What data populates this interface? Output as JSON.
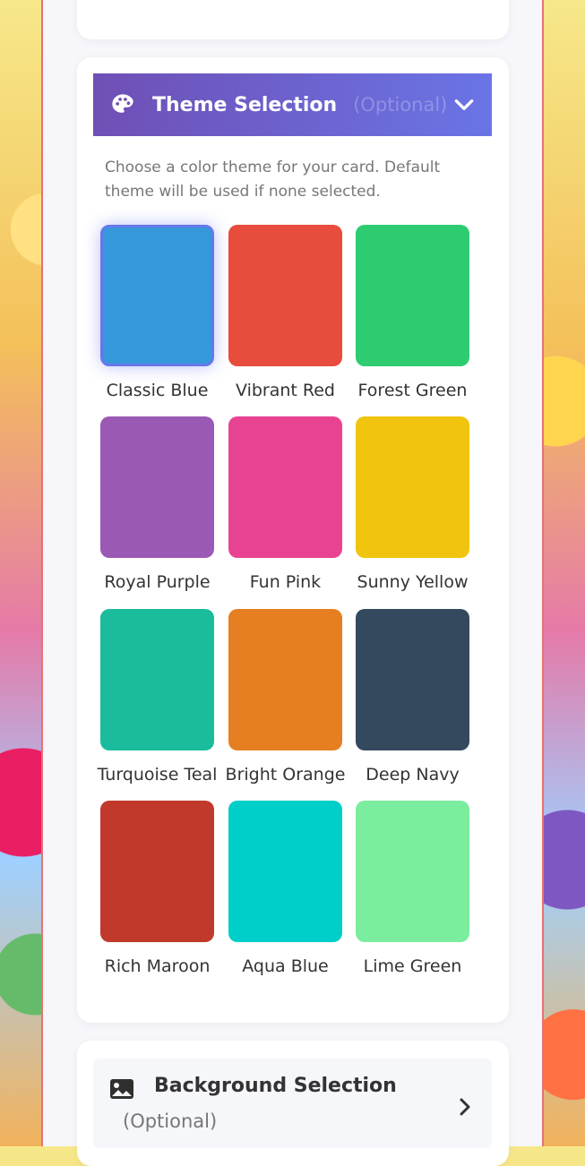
{
  "theme_section": {
    "title": "Theme Selection",
    "optional_label": "(Optional)",
    "description": "Choose a color theme for your card. Default theme will be used if none selected.",
    "selected": "Classic Blue",
    "themes": [
      {
        "name": "Classic Blue",
        "color": "#3498db"
      },
      {
        "name": "Vibrant Red",
        "color": "#e74c3c"
      },
      {
        "name": "Forest Green",
        "color": "#2ecc71"
      },
      {
        "name": "Royal Purple",
        "color": "#9b59b6"
      },
      {
        "name": "Fun Pink",
        "color": "#e84393"
      },
      {
        "name": "Sunny Yellow",
        "color": "#f1c40f"
      },
      {
        "name": "Turquoise Teal",
        "color": "#1abc9c"
      },
      {
        "name": "Bright Orange",
        "color": "#e67e22"
      },
      {
        "name": "Deep Navy",
        "color": "#34495e"
      },
      {
        "name": "Rich Maroon",
        "color": "#c0392b"
      },
      {
        "name": "Aqua Blue",
        "color": "#00cec9"
      },
      {
        "name": "Lime Green",
        "color": "#7bed9f"
      }
    ]
  },
  "background_section": {
    "title": "Background Selection",
    "optional_label": "(Optional)"
  },
  "icons": {
    "theme_header": "palette-icon",
    "theme_toggle": "chevron-down-icon",
    "background_header": "image-icon",
    "background_toggle": "chevron-right-icon"
  }
}
